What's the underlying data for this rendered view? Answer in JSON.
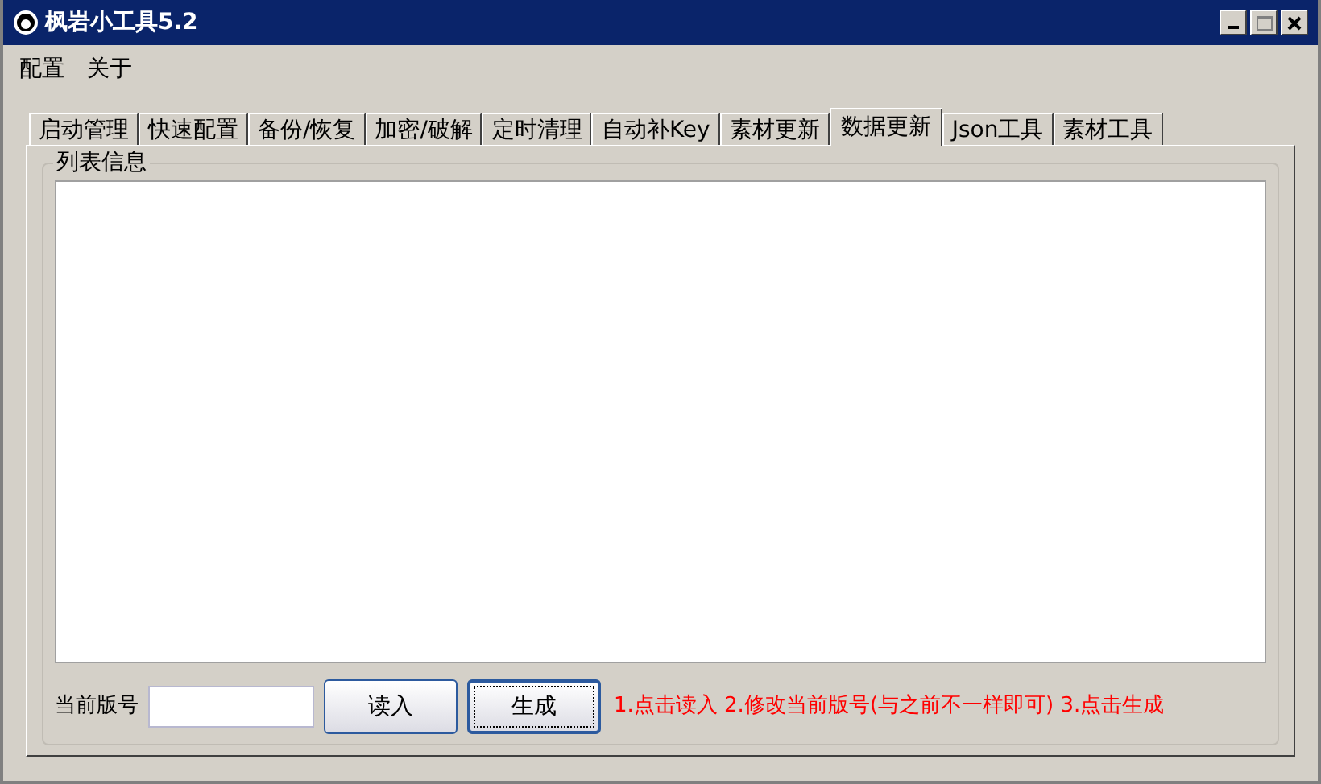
{
  "window": {
    "title": "枫岩小工具5.2"
  },
  "menu": [
    "配置",
    "关于"
  ],
  "tabs": [
    {
      "label": "启动管理",
      "selected": false
    },
    {
      "label": "快速配置",
      "selected": false
    },
    {
      "label": "备份/恢复",
      "selected": false
    },
    {
      "label": "加密/破解",
      "selected": false
    },
    {
      "label": "定时清理",
      "selected": false
    },
    {
      "label": "自动补Key",
      "selected": false
    },
    {
      "label": "素材更新",
      "selected": false
    },
    {
      "label": "数据更新",
      "selected": true
    },
    {
      "label": "Json工具",
      "selected": false
    },
    {
      "label": "素材工具",
      "selected": false
    }
  ],
  "group": {
    "title": "列表信息"
  },
  "version": {
    "label": "当前版号"
  },
  "buttons": [
    {
      "label": "读入",
      "focused": false
    },
    {
      "label": "生成",
      "focused": true
    }
  ],
  "hint": "1.点击读入 2.修改当前版号(与之前不一样即可) 3.点击生成"
}
